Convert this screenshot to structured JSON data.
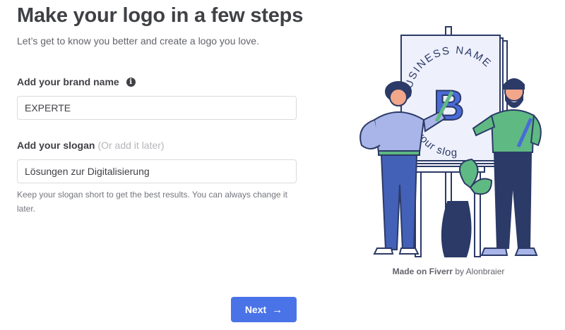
{
  "page": {
    "title": "Make your logo in a few steps",
    "subtitle": "Let’s get to know you better and create a logo you love."
  },
  "brand_name": {
    "label": "Add your brand name",
    "info_icon": "info-icon",
    "value": "EXPERTE"
  },
  "slogan": {
    "label": "Add your slogan",
    "optional_note": "(Or add it later)",
    "value": "Lösungen zur Digitalisierung",
    "hint": "Keep your slogan short to get the best results. You can always change it later."
  },
  "next_button": {
    "label": "Next",
    "icon": "arrow-right-icon",
    "color": "#4a73e8"
  },
  "illustration": {
    "canvas_text_top": "BUSINESS NAME",
    "canvas_text_bottom": "your slog",
    "canvas_letter": "B"
  },
  "credit": {
    "brand": "Made on Fiverr",
    "by": "by Alonbraier"
  }
}
